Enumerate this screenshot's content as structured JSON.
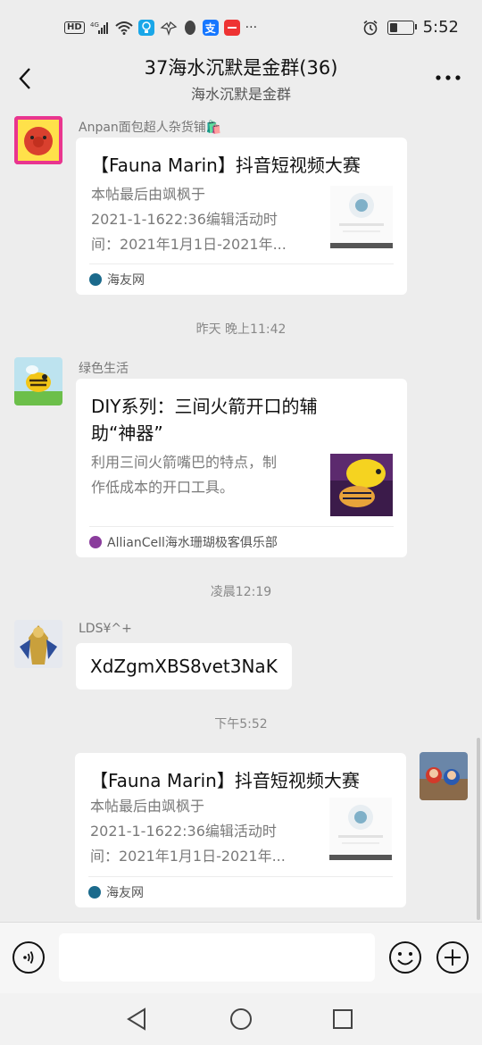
{
  "status_bar": {
    "time": "5:52",
    "network": "4G",
    "hd": "HD",
    "more": "···",
    "battery_level": 0.35,
    "icons": [
      "hd-icon",
      "signal-icon",
      "wifi-icon",
      "lightbulb-app-icon",
      "eagle-app-icon",
      "qq-penguin-icon",
      "alipay-icon",
      "taobao-icon",
      "more-icon",
      "alarm-icon",
      "battery-icon"
    ]
  },
  "header": {
    "title": "37海水沉默是金群(36)",
    "subtitle": "海水沉默是金群"
  },
  "messages": [
    {
      "type": "link_card",
      "sender": "Anpan面包超人杂货铺🛍️",
      "title": "【Fauna Marin】抖音短视频大赛",
      "desc_lines": [
        "本帖最后由飒枫于",
        "2021-1-1622:36编辑活动时",
        "间：2021年1月1日-2021年..."
      ],
      "source": "海友网"
    },
    {
      "type": "timestamp",
      "text": "昨天 晚上11:42"
    },
    {
      "type": "link_card",
      "sender": "绿色生活",
      "title_lines": [
        "DIY系列：三间火箭开口的辅",
        "助“神器”"
      ],
      "desc_lines": [
        "利用三间火箭嘴巴的特点，制",
        "作低成本的开口工具。"
      ],
      "source": "AllianCell海水珊瑚极客俱乐部"
    },
    {
      "type": "timestamp",
      "text": "凌晨12:19"
    },
    {
      "type": "text",
      "sender": "LDS¥^+",
      "text": "XdZgmXBS8vet3NaK"
    },
    {
      "type": "timestamp",
      "text": "下午5:52"
    },
    {
      "type": "link_card_self",
      "title": "【Fauna Marin】抖音短视频大赛",
      "desc_lines": [
        "本帖最后由飒枫于",
        "2021-1-1622:36编辑活动时",
        "间：2021年1月1日-2021年..."
      ],
      "source": "海友网"
    }
  ],
  "input": {
    "placeholder": ""
  },
  "colors": {
    "background": "#ededed",
    "card": "#ffffff",
    "accent_red": "#ee3333",
    "link_blue": "#1e88e5"
  }
}
